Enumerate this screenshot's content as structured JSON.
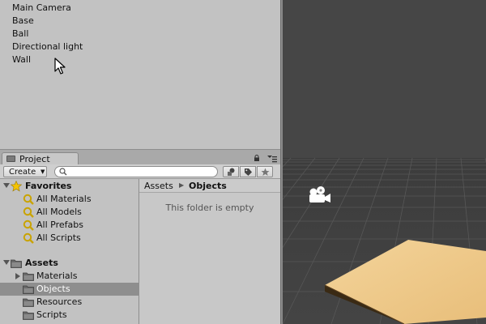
{
  "hierarchy": {
    "items": [
      "Main Camera",
      "Base",
      "Ball",
      "Directional light",
      "Wall"
    ]
  },
  "project": {
    "tab_label": "Project",
    "create_label": "Create",
    "search_placeholder": "",
    "tree": {
      "favorites": {
        "label": "Favorites",
        "items": [
          "All Materials",
          "All Models",
          "All Prefabs",
          "All Scripts"
        ]
      },
      "assets": {
        "label": "Assets",
        "items": [
          {
            "label": "Materials",
            "has_children": true,
            "selected": false
          },
          {
            "label": "Objects",
            "has_children": false,
            "selected": true
          },
          {
            "label": "Resources",
            "has_children": false,
            "selected": false
          },
          {
            "label": "Scripts",
            "has_children": false,
            "selected": false
          }
        ]
      }
    },
    "breadcrumb": [
      "Assets",
      "Objects"
    ],
    "empty_message": "This folder is empty"
  },
  "colors": {
    "panel_bg": "#c2c2c2",
    "selected_row": "#8e8e8e",
    "scene_bg": "#464646",
    "wood": "#f0c98a",
    "star": "#f5c400"
  },
  "icons": {
    "favorites": "star-icon",
    "saved_search": "magnifier-icon",
    "folder": "folder-icon",
    "scene_camera": "camera-icon"
  }
}
